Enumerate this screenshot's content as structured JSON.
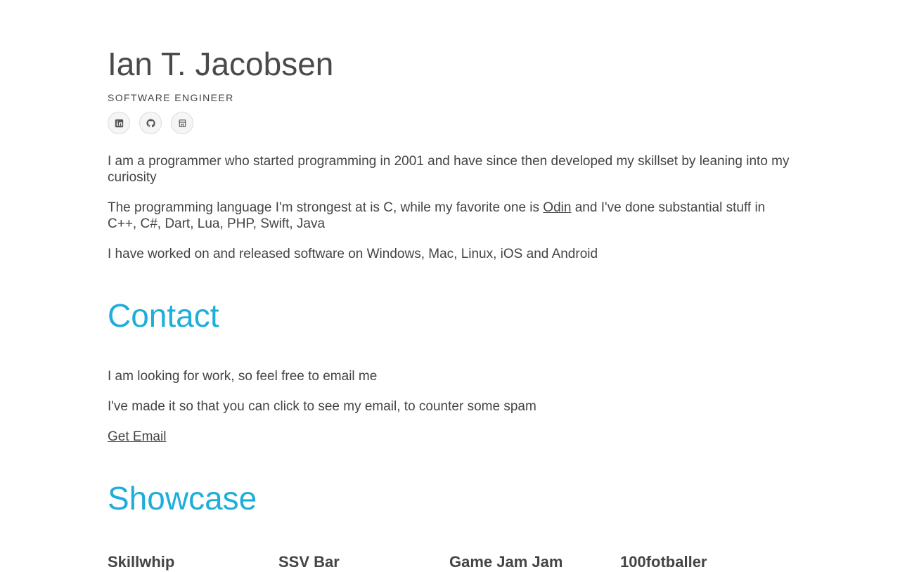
{
  "header": {
    "name": "Ian T. Jacobsen",
    "title": "SOFTWARE ENGINEER"
  },
  "socials": [
    {
      "icon": "linkedin-icon"
    },
    {
      "icon": "github-icon"
    },
    {
      "icon": "store-icon"
    }
  ],
  "intro": {
    "p1": "I am a programmer who started programming in 2001 and have since then developed my skillset by leaning into my curiosity",
    "p2_before": "The programming language I'm strongest at is C, while my favorite one is ",
    "p2_link": "Odin",
    "p2_after": " and I've done substantial stuff in C++, C#, Dart, Lua, PHP, Swift, Java",
    "p3": "I have worked on and released software on Windows, Mac, Linux, iOS and Android"
  },
  "contact": {
    "heading": "Contact",
    "line1": "I am looking for work, so feel free to email me",
    "line2": "I've made it so that you can click to see my email, to counter some spam",
    "link": "Get Email"
  },
  "showcase": {
    "heading": "Showcase",
    "items": [
      "Skillwhip",
      "SSV Bar",
      "Game Jam Jam",
      "100fotballer"
    ]
  },
  "colors": {
    "accent": "#1eaedb",
    "text": "#444444"
  }
}
